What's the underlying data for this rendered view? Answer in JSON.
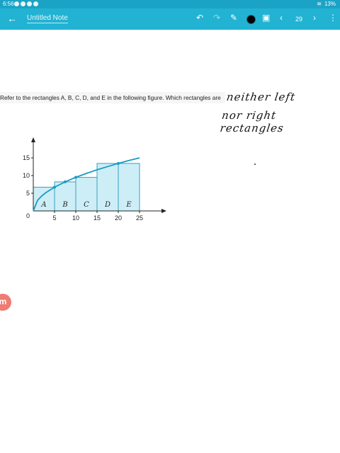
{
  "status": {
    "time": "6:56",
    "battery": "13%"
  },
  "toolbar": {
    "title": "Untitled Note",
    "page_number": "29",
    "pen_color": "#000000"
  },
  "question": {
    "text": "Refer to the rectangles A, B, C, D, and E in the following figure. Which rectangles are"
  },
  "handwriting": {
    "line1": "neither left",
    "line2": "nor right rectangles"
  },
  "chart_data": {
    "type": "area",
    "x_ticks": [
      "5",
      "10",
      "15",
      "20",
      "25"
    ],
    "y_ticks": [
      "5",
      "10",
      "15"
    ],
    "origin_label": "0",
    "xlim": [
      0,
      25
    ],
    "ylim": [
      0,
      15
    ],
    "curve": "sqrt",
    "curve_points": [
      [
        0,
        0
      ],
      [
        1,
        3
      ],
      [
        2,
        4.24
      ],
      [
        3,
        5.2
      ],
      [
        5,
        6.71
      ],
      [
        7.5,
        8.22
      ],
      [
        10,
        9.49
      ],
      [
        12.5,
        10.61
      ],
      [
        15,
        11.62
      ],
      [
        17.5,
        12.55
      ],
      [
        20,
        13.42
      ],
      [
        22.5,
        14.23
      ],
      [
        25,
        15
      ]
    ],
    "rectangles": [
      {
        "label": "A",
        "x0": 0,
        "x1": 5,
        "height": 6.71
      },
      {
        "label": "B",
        "x0": 5,
        "x1": 10,
        "height": 8.22
      },
      {
        "label": "C",
        "x0": 10,
        "x1": 15,
        "height": 9.49
      },
      {
        "label": "D",
        "x0": 15,
        "x1": 20,
        "height": 13.42
      },
      {
        "label": "E",
        "x0": 20,
        "x1": 25,
        "height": 13.42
      }
    ],
    "marked_points": [
      [
        5,
        6.71
      ],
      [
        7.5,
        8.22
      ],
      [
        10,
        9.49
      ],
      [
        20,
        13.42
      ]
    ],
    "colors": {
      "curve": "#1a9bc2",
      "fill": "#cdeef7",
      "edge": "#3a9fc0"
    }
  },
  "brand": {
    "logo_letter": "m"
  }
}
